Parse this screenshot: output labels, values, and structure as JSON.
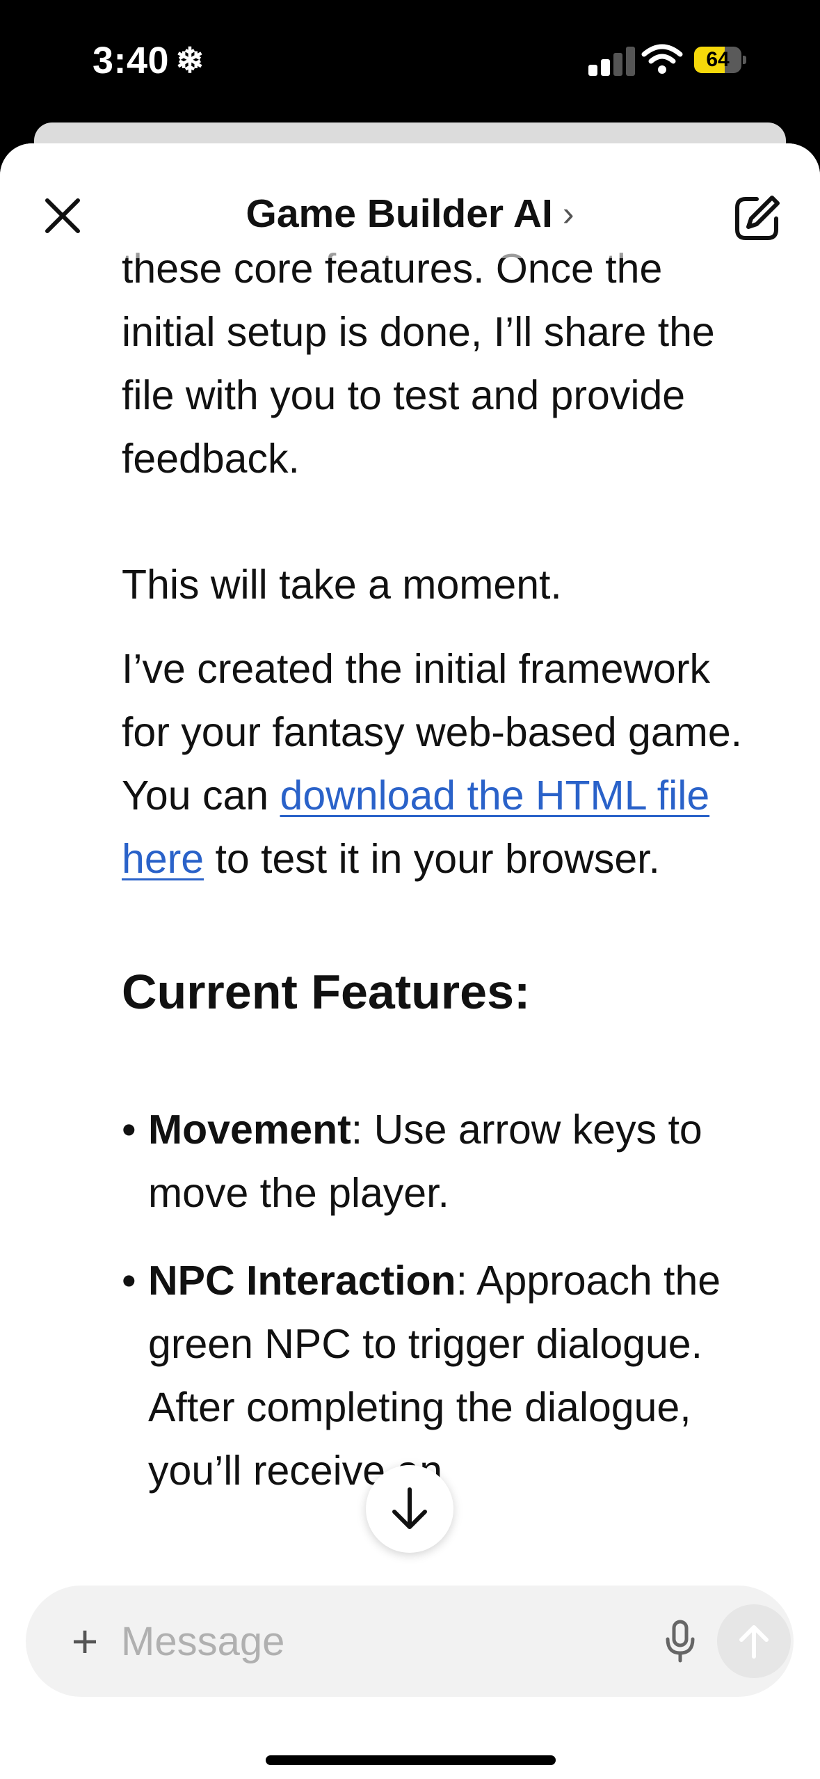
{
  "status_bar": {
    "time": "3:40",
    "status_glyph": "❄",
    "battery_level": "64",
    "icons": [
      "snowflake-icon",
      "cellular-signal-icon",
      "wifi-icon",
      "battery-icon"
    ],
    "signal_bars_active": 2,
    "signal_bars_total": 4,
    "battery_fraction": 0.64
  },
  "header": {
    "title": "Game Builder AI",
    "chevron": "›",
    "icons": [
      "close-icon",
      "chevron-right-icon",
      "new-chat-edit-icon"
    ]
  },
  "message": {
    "partial_top": "these core features. Once the initial setup is done, I’ll share the file with you to test and provide feedback.",
    "wait_line": "This will take a moment.",
    "para2_before": "I’ve created the initial framework for your fantasy web-based game. You can",
    "link_text": "download the HTML file here",
    "para2_after": "to test it in your browser.",
    "heading": "Current Features:",
    "features": [
      {
        "bullet": "•",
        "title": "Movement",
        "text": ": Use arrow keys to move the player."
      },
      {
        "bullet": "•",
        "title": "NPC Interaction",
        "text": ": Approach the green NPC to trigger dialogue. After completing the dialogue, you’ll receive an"
      }
    ]
  },
  "composer": {
    "plus": "+",
    "placeholder": "Message",
    "value": "",
    "icons": [
      "plus-icon",
      "microphone-icon",
      "send-arrow-icon",
      "scroll-down-arrow-icon"
    ]
  },
  "colors": {
    "link": "#2a62c9",
    "battery": "#f5d80a",
    "input_bg": "#f2f2f2",
    "send_bg": "#e6e6e6"
  }
}
